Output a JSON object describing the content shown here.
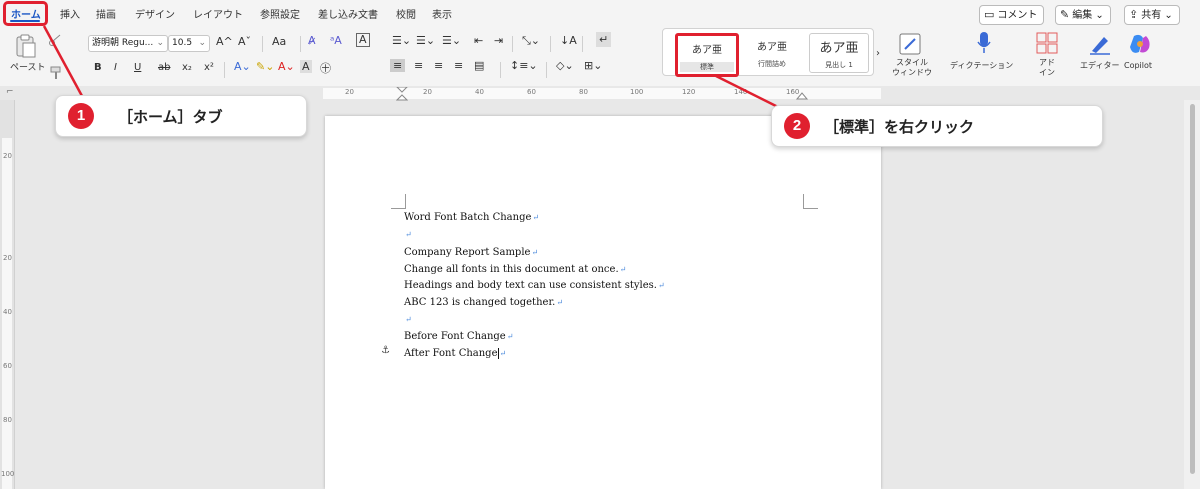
{
  "tabs": [
    "ホーム",
    "挿入",
    "描画",
    "デザイン",
    "レイアウト",
    "参照設定",
    "差し込み文書",
    "校閲",
    "表示"
  ],
  "top_buttons": {
    "comment": {
      "label": "コメント",
      "icon": "comment-icon"
    },
    "edit": {
      "label": "編集",
      "icon": "pencil-icon"
    },
    "share": {
      "label": "共有",
      "icon": "share-icon"
    }
  },
  "ribbon": {
    "paste_label": "ペースト",
    "font_name": "游明朝 Regu...",
    "font_size": "10.5",
    "font_grow": "A^",
    "font_shrink": "Aˇ",
    "change_case": "Aa",
    "bold": "B",
    "italic": "I",
    "underline": "U",
    "strike": "ab",
    "subscript": "x₂",
    "superscript": "x²",
    "styles": [
      {
        "preview": "あア亜",
        "name": "標準"
      },
      {
        "preview": "あア亜",
        "name": "行間詰め"
      },
      {
        "preview": "あア亜",
        "name": "見出し 1"
      }
    ],
    "style_window_label": "スタイル\nウィンドウ",
    "dictation_label": "ディクテーション",
    "addins_label": "アド\nイン",
    "editor_label": "エディター",
    "copilot_label": "Copilot"
  },
  "ruler": {
    "h_numbers": [
      "20",
      "20",
      "40",
      "60",
      "80",
      "100",
      "120",
      "140",
      "160"
    ],
    "v_numbers": [
      "20",
      "20",
      "40",
      "60",
      "80",
      "100"
    ]
  },
  "document": {
    "lines": [
      "Word Font Batch Change",
      "",
      "Company Report Sample",
      "Change all fonts in this document at once.",
      "Headings and body text can use consistent styles.",
      "ABC 123 is changed together.",
      "",
      "Before Font Change",
      "After Font Change"
    ]
  },
  "callouts": [
    {
      "number": "1",
      "text": "［ホーム］タブ"
    },
    {
      "number": "2",
      "text": "［標準］を右クリック"
    }
  ],
  "colors": {
    "accent": "#1a56c4",
    "highlight": "#e0202f"
  }
}
